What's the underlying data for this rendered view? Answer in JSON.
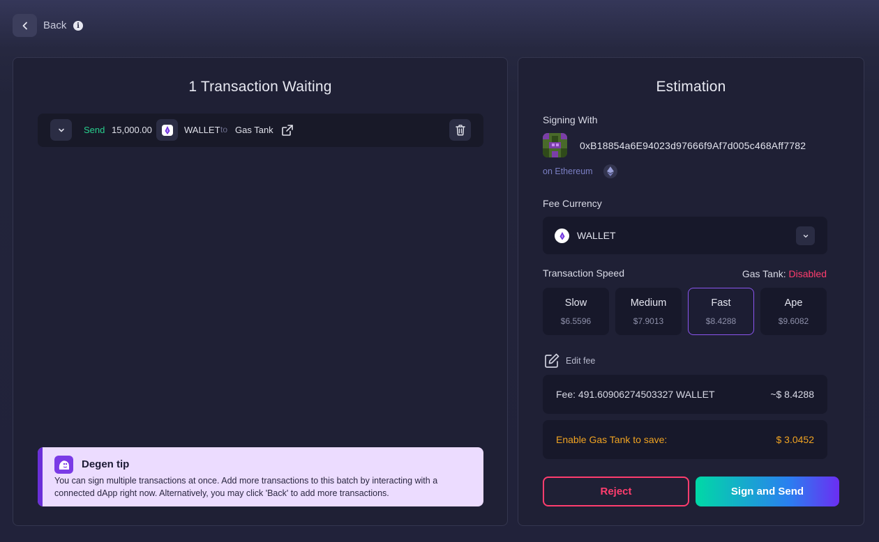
{
  "header": {
    "back_label": "Back",
    "back_icon": "chevron-left-icon",
    "info_icon": "info-icon"
  },
  "left_panel": {
    "title": "1 Transaction Waiting",
    "transaction": {
      "action": "Send",
      "amount": "15,000.00",
      "token": "WALLET",
      "to_label": "to",
      "destination": "Gas Tank",
      "action_color": "#28d08e"
    },
    "tip": {
      "title": "Degen tip",
      "text": "You can sign multiple transactions at once. Add more transactions to this batch by interacting with a connected dApp right now. Alternatively, you may click 'Back' to add more transactions."
    }
  },
  "right_panel": {
    "title": "Estimation",
    "signing_label": "Signing With",
    "address": "0xB18854a6E94023d97666f9Af7d005c468Aff7782",
    "network": "on Ethereum",
    "fee_currency_label": "Fee Currency",
    "fee_currency_value": "WALLET",
    "speed_label": "Transaction Speed",
    "gas_tank_label": "Gas Tank:",
    "gas_tank_status": "Disabled",
    "speeds": [
      {
        "name": "Slow",
        "price": "$6.5596"
      },
      {
        "name": "Medium",
        "price": "$7.9013"
      },
      {
        "name": "Fast",
        "price": "$8.4288",
        "selected": true
      },
      {
        "name": "Ape",
        "price": "$9.6082"
      }
    ],
    "edit_fee_label": "Edit fee",
    "fee_text": "Fee: 491.60906274503327 WALLET",
    "fee_usd": "~$ 8.4288",
    "save_text": "Enable Gas Tank to save:",
    "save_amount": "$ 3.0452",
    "reject_label": "Reject",
    "sign_label": "Sign and Send"
  },
  "colors": {
    "accent_purple": "#8b55f0",
    "danger": "#ff3d6e",
    "warning": "#f0a322",
    "success": "#28d08e"
  }
}
